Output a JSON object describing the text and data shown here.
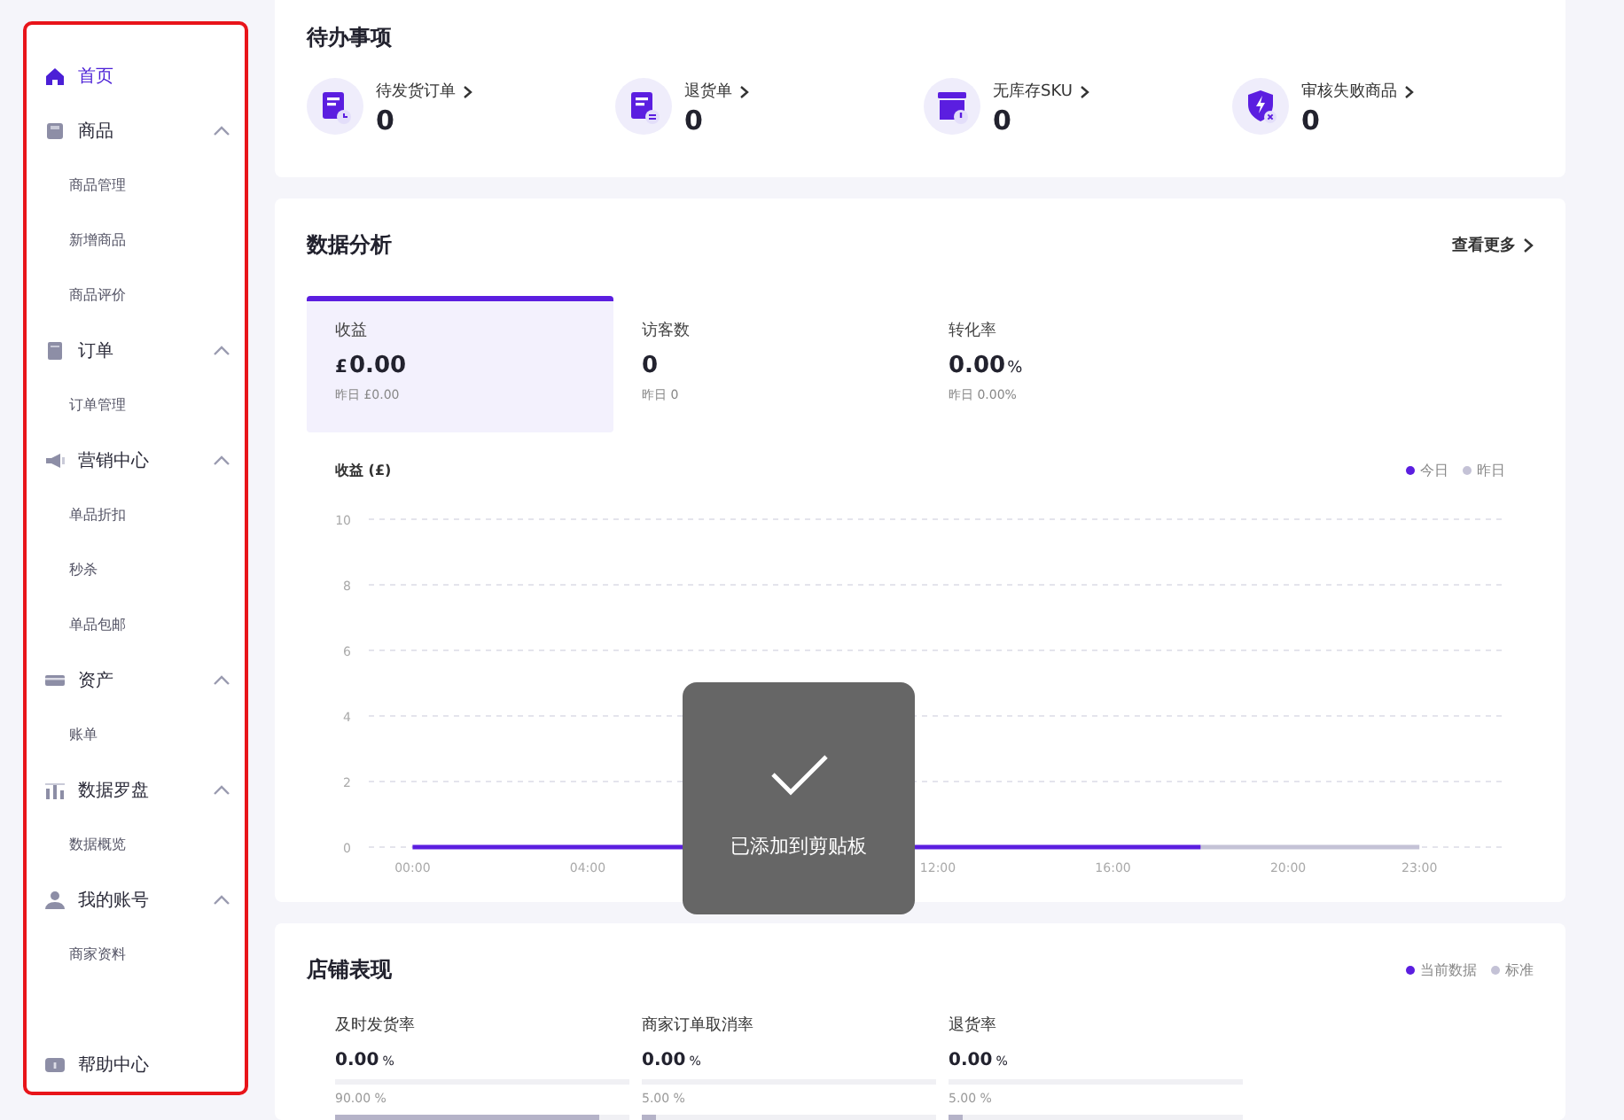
{
  "sidebar": {
    "items": [
      {
        "label": "首页",
        "selected": true
      },
      {
        "label": "商品",
        "expanded": true,
        "children": [
          {
            "label": "商品管理",
            "selected": false
          },
          {
            "label": "新增商品",
            "selected": false
          },
          {
            "label": "商品评价",
            "selected": false
          }
        ]
      },
      {
        "label": "订单",
        "expanded": true,
        "children": [
          {
            "label": "订单管理",
            "selected": false
          }
        ]
      },
      {
        "label": "营销中心",
        "expanded": true,
        "children": [
          {
            "label": "单品折扣",
            "selected": false
          },
          {
            "label": "秒杀",
            "selected": false
          },
          {
            "label": "单品包邮",
            "selected": false
          }
        ]
      },
      {
        "label": "资产",
        "expanded": true,
        "children": [
          {
            "label": "账单",
            "selected": false
          }
        ]
      },
      {
        "label": "数据罗盘",
        "expanded": true,
        "children": [
          {
            "label": "数据概览",
            "selected": false
          }
        ]
      },
      {
        "label": "我的账号",
        "expanded": true,
        "children": [
          {
            "label": "商家资料",
            "selected": false
          }
        ]
      }
    ],
    "footer": {
      "label": "帮助中心"
    }
  },
  "todo": {
    "title": "待办事项",
    "items": [
      {
        "label": "待发货订单",
        "count": "0"
      },
      {
        "label": "退货单",
        "count": "0"
      },
      {
        "label": "无库存SKU",
        "count": "0"
      },
      {
        "label": "审核失败商品",
        "count": "0"
      }
    ]
  },
  "analytics": {
    "title": "数据分析",
    "more": "查看更多",
    "tabs": [
      {
        "label": "收益",
        "currency": "£",
        "value": "0.00",
        "yesterday": "昨日 £0.00",
        "selected": true
      },
      {
        "label": "访客数",
        "value": "0",
        "yesterday": "昨日 0",
        "selected": false
      },
      {
        "label": "转化率",
        "value": "0.00",
        "unit": "%",
        "yesterday": "昨日 0.00%",
        "selected": false
      }
    ],
    "chart_title": "收益 (£)",
    "chart_data": {
      "type": "line",
      "x": [
        0,
        1,
        2,
        3,
        4,
        5,
        12,
        13,
        14,
        15,
        16,
        17,
        18,
        19,
        20,
        21,
        22,
        23
      ],
      "series": [
        {
          "name": "今日",
          "color": "#5b1ee0",
          "values": [
            0,
            0,
            0,
            0,
            0,
            0,
            0,
            0,
            0,
            0,
            0,
            0,
            0,
            null,
            null,
            null,
            null,
            null
          ]
        },
        {
          "name": "昨日",
          "color": "#c4c2d6",
          "values": [
            null,
            null,
            null,
            null,
            null,
            null,
            null,
            null,
            null,
            null,
            null,
            null,
            0,
            0,
            0,
            0,
            0,
            0
          ]
        }
      ],
      "grid": true,
      "xlim": [
        -1,
        25
      ],
      "ylim": [
        0,
        10
      ],
      "yticks": [
        0,
        2,
        4,
        6,
        8,
        10
      ],
      "xticks": [
        {
          "value": 0,
          "label": "00:00"
        },
        {
          "value": 4,
          "label": "04:00"
        },
        {
          "value": 12,
          "label": "12:00"
        },
        {
          "value": 16,
          "label": "16:00"
        },
        {
          "value": 20,
          "label": "20:00"
        },
        {
          "value": 23,
          "label": "23:00"
        }
      ]
    }
  },
  "store": {
    "title": "店铺表现",
    "legend": [
      {
        "label": "当前数据",
        "color": "#5b1ee0"
      },
      {
        "label": "标准",
        "color": "#c4c2d6"
      }
    ],
    "metrics": [
      {
        "label": "及时发货率",
        "value": "0.00",
        "unit": "%",
        "current": {
          "level": 0
        },
        "standard": {
          "text": "90.00 %",
          "level": 0.9
        }
      },
      {
        "label": "商家订单取消率",
        "value": "0.00",
        "unit": "%",
        "current": {
          "level": 0
        },
        "standard": {
          "text": "5.00 %",
          "level": 0.05
        }
      },
      {
        "label": "退货率",
        "value": "0.00",
        "unit": "%",
        "current": {
          "level": 0
        },
        "standard": {
          "text": "5.00 %",
          "level": 0.05
        }
      }
    ]
  },
  "toast": {
    "message": "已添加到剪贴板"
  }
}
